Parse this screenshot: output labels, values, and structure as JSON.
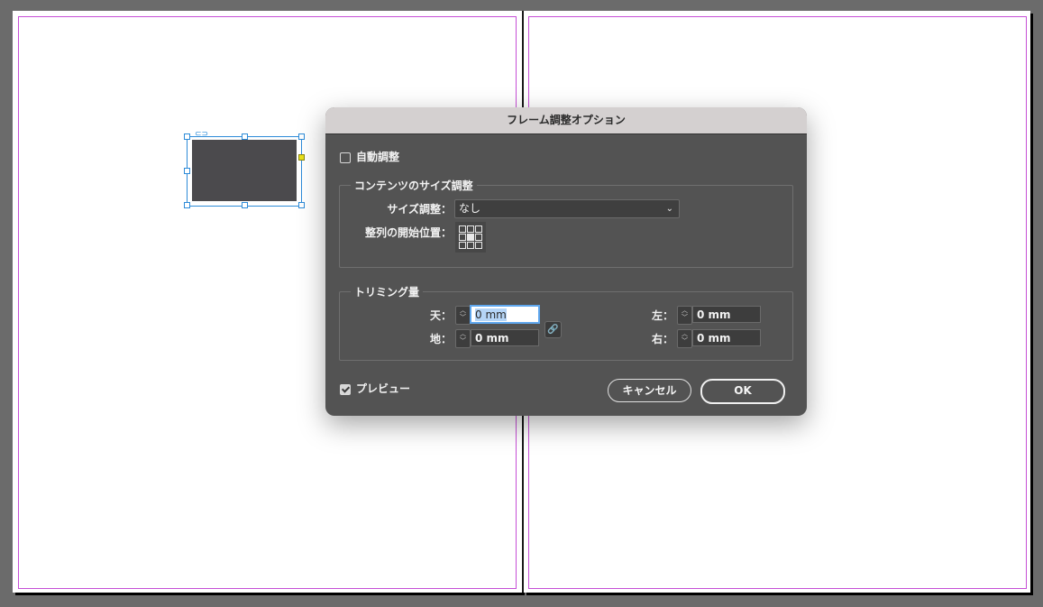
{
  "dialog": {
    "title": "フレーム調整オプション",
    "auto_fit_label": "自動調整",
    "auto_fit_checked": false,
    "content_group_title": "コンテンツのサイズ調整",
    "fitting_label": "サイズ調整：",
    "fitting_value": "なし",
    "align_from_label": "整列の開始位置：",
    "crop_group_title": "トリミング量",
    "fields": {
      "top": {
        "label": "天：",
        "value": "0 mm"
      },
      "bottom": {
        "label": "地：",
        "value": "0 mm"
      },
      "left": {
        "label": "左：",
        "value": "0 mm"
      },
      "right": {
        "label": "右：",
        "value": "0 mm"
      }
    },
    "preview_label": "プレビュー",
    "preview_checked": true,
    "cancel_label": "キャンセル",
    "ok_label": "OK"
  },
  "colors": {
    "selection": "#2d8bd8",
    "margin_guide": "#c64fd6",
    "frame_fill": "#4b4a4d",
    "dialog_bg": "#535353"
  }
}
